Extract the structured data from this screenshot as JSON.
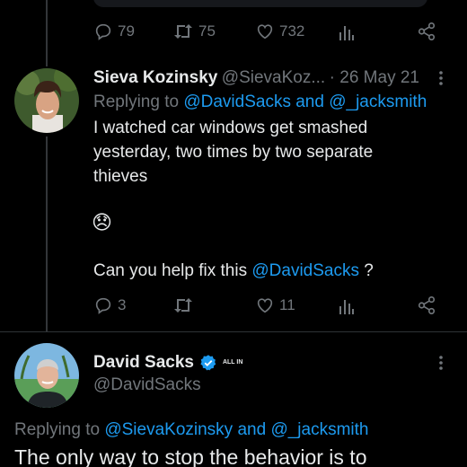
{
  "top_actions": {
    "replies": "79",
    "reposts": "75",
    "likes": "732"
  },
  "reply1": {
    "name": "Sieva Kozinsky",
    "handle": "@SievaKoz...",
    "date": "· 26 May 21",
    "replying_prefix": "Replying to",
    "mention1": "@DavidSacks",
    "and_word": "and",
    "mention2": "@_jacksmith",
    "text_line1": "I watched car windows get smashed",
    "text_line2": "yesterday, two times by two separate",
    "text_line3": "thieves",
    "emoji": "😞",
    "question_prefix": "Can you help fix this",
    "question_mention": "@DavidSacks",
    "question_suffix": "?",
    "replies": "3",
    "reposts": "",
    "likes": "11"
  },
  "reply2": {
    "name": "David Sacks",
    "badge_label": "ALL IN",
    "handle": "@DavidSacks",
    "replying_prefix": "Replying to",
    "mention1": "@SievaKozinsky",
    "and_word": "and",
    "mention2": "@_jacksmith",
    "text_line1": "The only way to stop the behavior is to"
  },
  "colors": {
    "background": "#000000",
    "link": "#1d9bf0",
    "muted": "#71767b",
    "verified": "#1d9bf0"
  }
}
